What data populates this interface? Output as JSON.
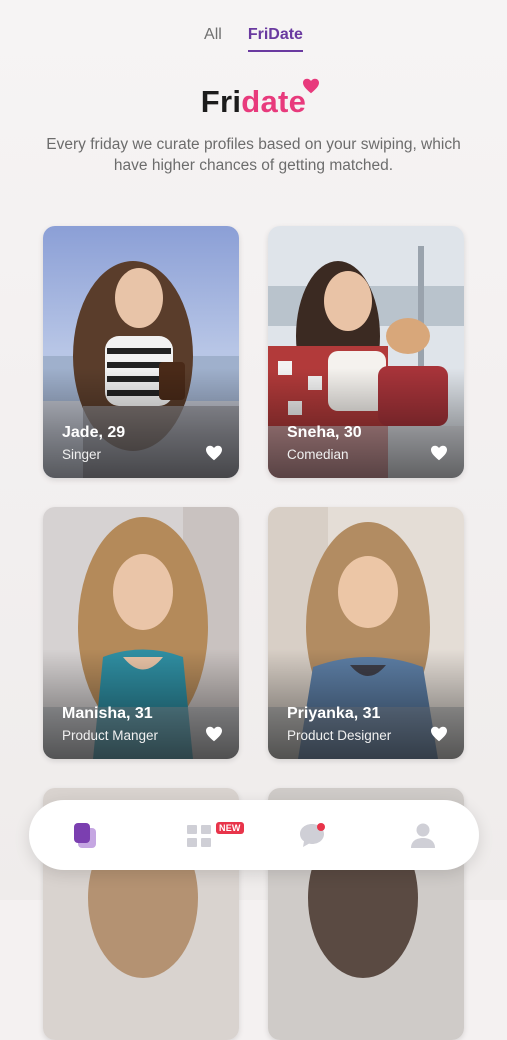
{
  "tabs": [
    {
      "label": "All",
      "active": false
    },
    {
      "label": "FriDate",
      "active": true
    }
  ],
  "logo": {
    "part1": "Fri",
    "part2": "date",
    "accent_color": "#e83a7c"
  },
  "subtitle": "Every friday we curate profiles based on your swiping, which have higher chances of getting matched.",
  "profiles": [
    {
      "name": "Jade, 29",
      "job": "Singer",
      "icon": "heart-icon"
    },
    {
      "name": "Sneha, 30",
      "job": "Comedian",
      "icon": "heart-icon"
    },
    {
      "name": "Manisha, 31",
      "job": "Product Manger",
      "icon": "heart-icon"
    },
    {
      "name": "Priyanka, 31",
      "job": "Product Designer",
      "icon": "heart-icon"
    }
  ],
  "nav": {
    "items": [
      "fridate-cards-icon",
      "grid-icon",
      "chat-icon",
      "profile-icon"
    ],
    "badge": "NEW",
    "active_color": "#7b3fb0"
  }
}
